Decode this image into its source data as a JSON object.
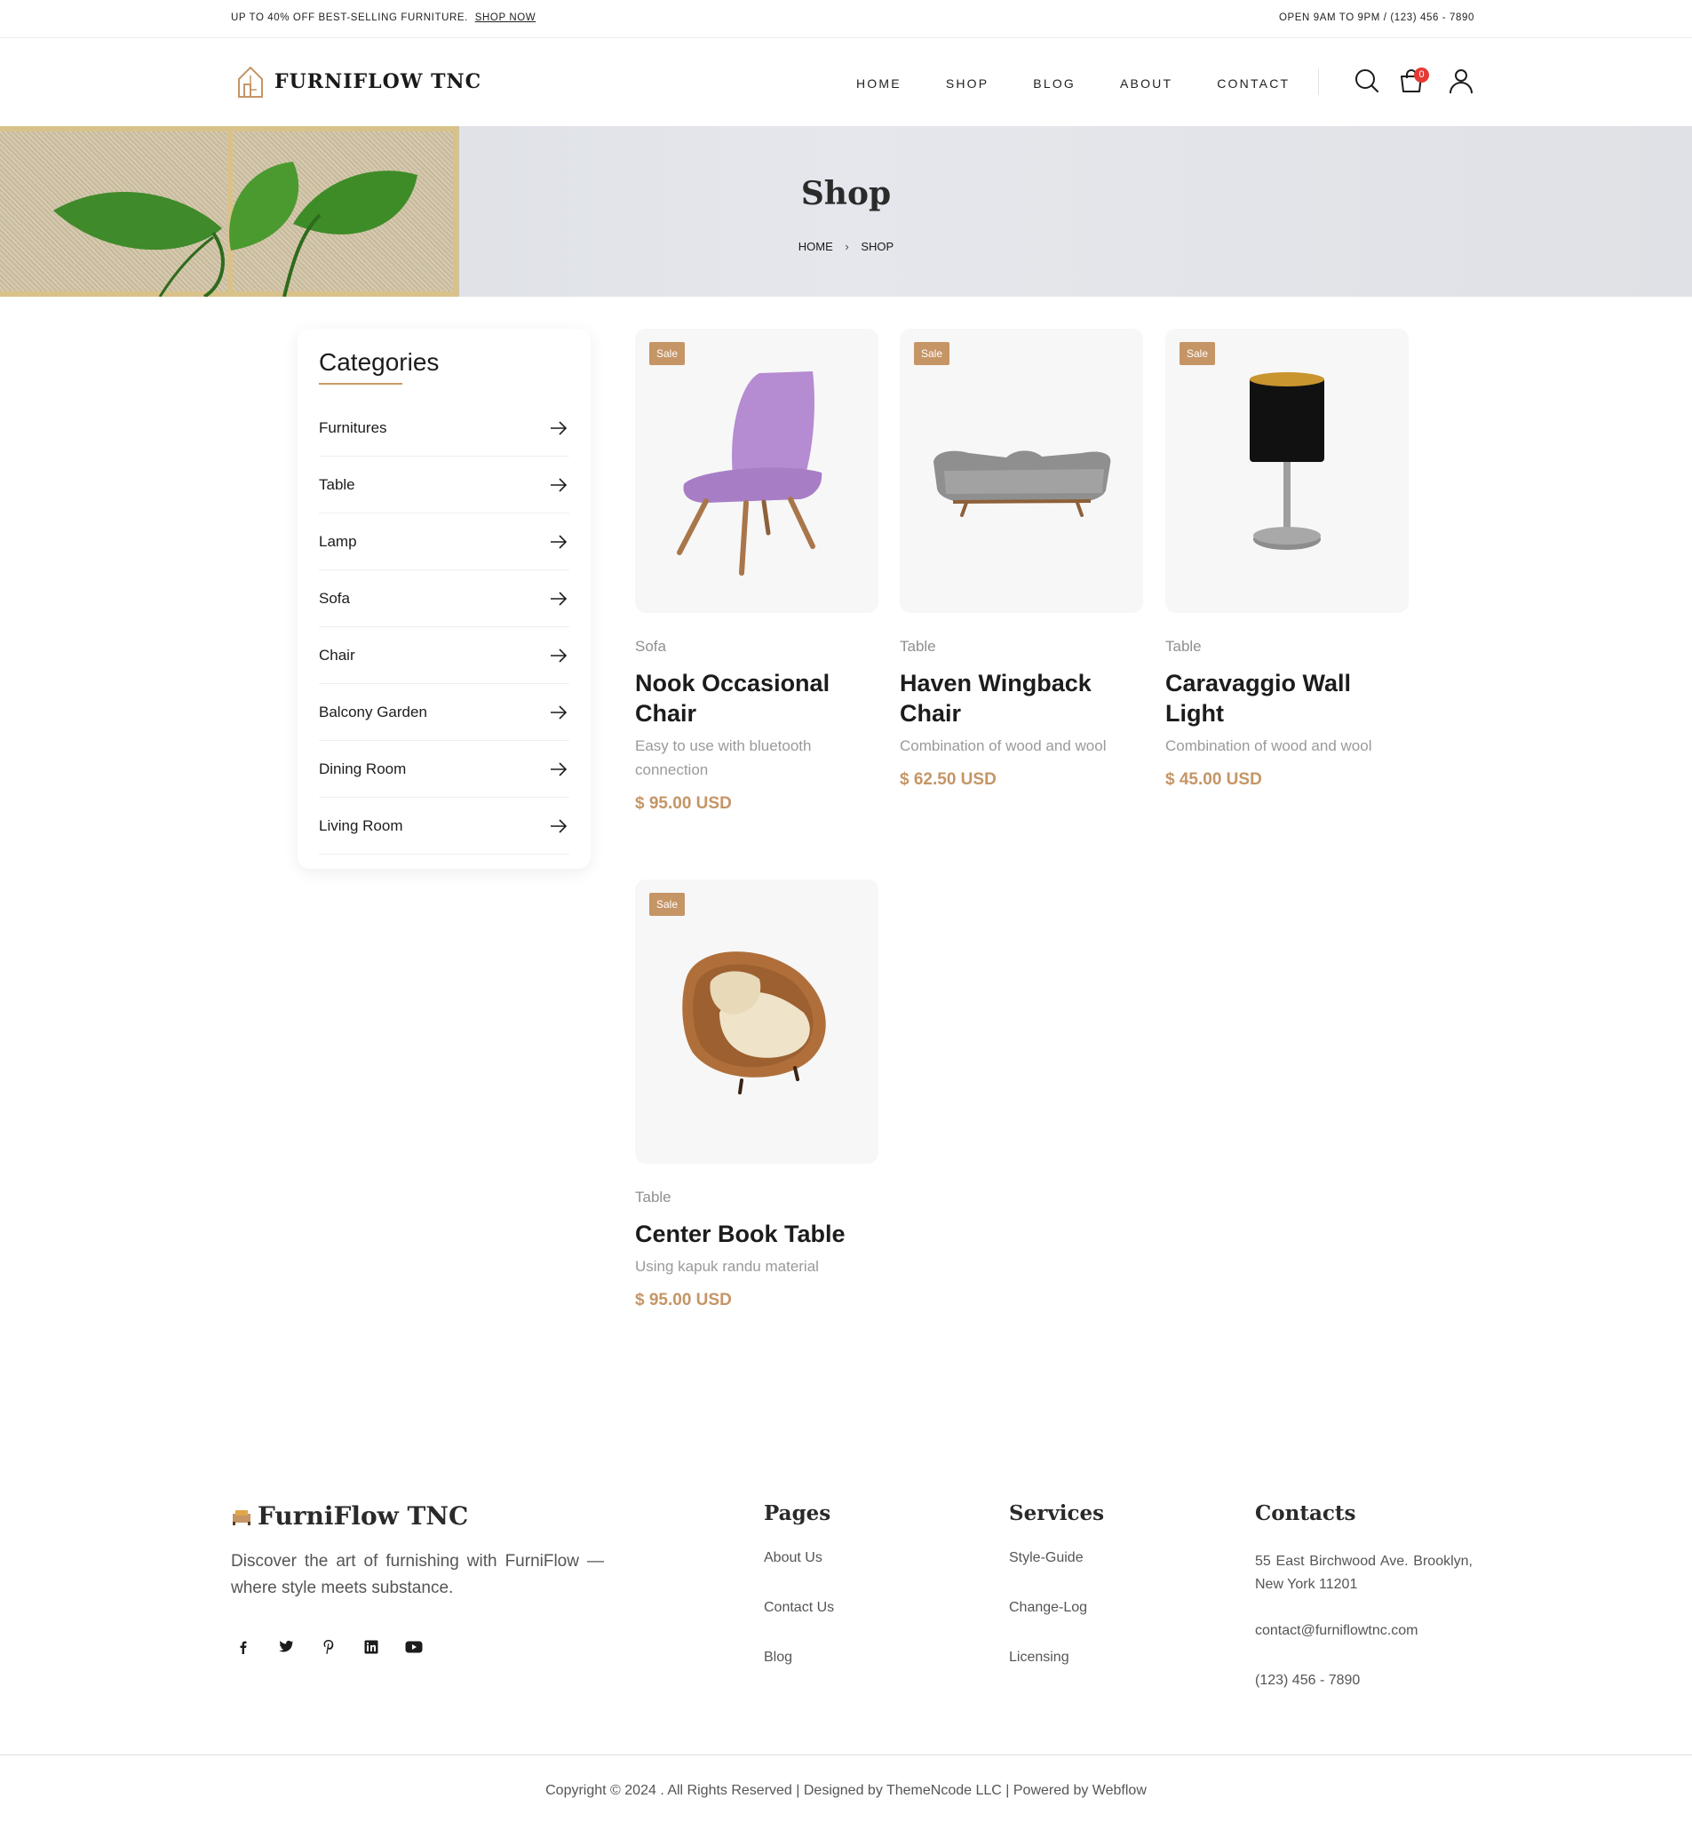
{
  "topbar": {
    "promo": "UP TO 40% OFF BEST-SELLING FURNITURE.",
    "promo_link": "SHOP NOW",
    "hours": "OPEN 9AM TO 9PM / (123) 456 - 7890"
  },
  "header": {
    "brand": "FURNIFLOW TNC",
    "nav": [
      "HOME",
      "SHOP",
      "BLOG",
      "ABOUT",
      "CONTACT"
    ],
    "cart_count": "0"
  },
  "hero": {
    "title": "Shop",
    "breadcrumb": [
      "HOME",
      "SHOP"
    ]
  },
  "sidebar": {
    "title": "Categories",
    "categories": [
      "Furnitures",
      "Table",
      "Lamp",
      "Sofa",
      "Chair",
      "Balcony Garden",
      "Dining Room",
      "Living Room"
    ]
  },
  "products": [
    {
      "badge": "Sale",
      "category": "Sofa",
      "name": "Nook Occasional Chair",
      "description": "Easy to use with bluetooth connection",
      "price": "$ 95.00 USD",
      "image_icon": "purple-chair"
    },
    {
      "badge": "Sale",
      "category": "Table",
      "name": "Haven Wingback Chair",
      "description": "Combination of wood and wool",
      "price": "$ 62.50 USD",
      "image_icon": "grey-sofa"
    },
    {
      "badge": "Sale",
      "category": "Table",
      "name": "Caravaggio Wall Light",
      "description": "Combination of wood and wool",
      "price": "$ 45.00 USD",
      "image_icon": "table-lamp"
    },
    {
      "badge": "Sale",
      "category": "Table",
      "name": "Center Book Table",
      "description": "Using kapuk randu material",
      "price": "$ 95.00 USD",
      "image_icon": "rattan-chair"
    }
  ],
  "footer": {
    "brand": "FurniFlow TNC",
    "about": "Discover the art of furnishing with FurniFlow — where style meets substance.",
    "socials": [
      "facebook-icon",
      "twitter-icon",
      "pinterest-icon",
      "linkedin-icon",
      "youtube-icon"
    ],
    "pages": {
      "title": "Pages",
      "links": [
        "About Us",
        "Contact Us",
        "Blog"
      ]
    },
    "services": {
      "title": "Services",
      "links": [
        "Style-Guide",
        "Change-Log",
        "Licensing"
      ]
    },
    "contacts": {
      "title": "Contacts",
      "address": "55 East Birchwood Ave. Brooklyn, New York 11201",
      "email": "contact@furniflowtnc.com",
      "phone": "(123) 456 - 7890"
    },
    "copyright": "Copyright © 2024 . All Rights Reserved |  Designed by ThemeNcode LLC | Powered by Webflow"
  },
  "colors": {
    "accent": "#c59566",
    "badge_red": "#e53935",
    "text_dark": "#1c1c1c",
    "text_muted": "#9a9a9a"
  }
}
